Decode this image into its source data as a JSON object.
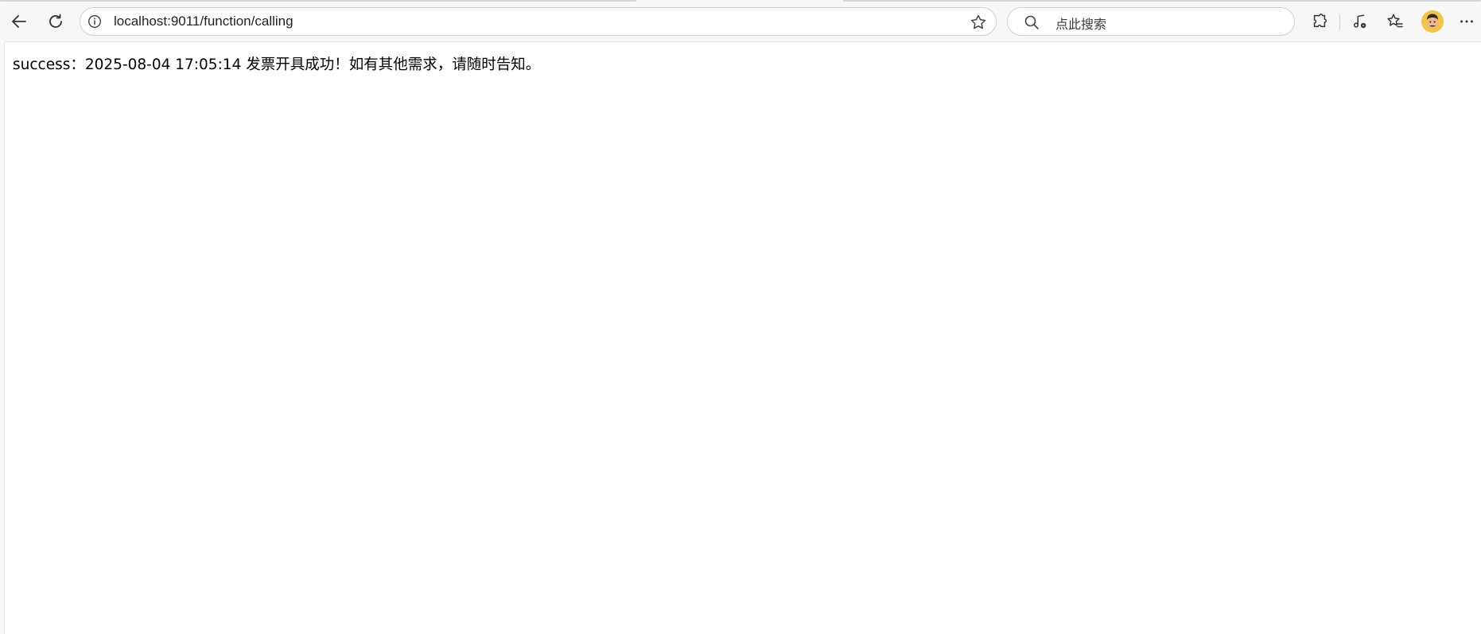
{
  "browser": {
    "address_bar": {
      "url": "localhost:9011/function/calling"
    },
    "search_box": {
      "placeholder": "点此搜索"
    },
    "icons": {
      "back": "back-arrow-icon",
      "refresh": "refresh-icon",
      "site_info": "info-icon",
      "favorite": "star-icon",
      "search": "search-icon",
      "extensions": "puzzle-icon",
      "media": "music-note-icon",
      "favorites_list": "favorites-icon",
      "profile": "avatar",
      "more": "more-dots-icon"
    }
  },
  "page": {
    "message": "success：2025-08-04 17:05:14 发票开具成功！如有其他需求，请随时告知。"
  },
  "colors": {
    "toolbar_bg": "#f7f7f7",
    "page_bg": "#ffffff",
    "text": "#000000",
    "avatar_bg": "#f4c542"
  }
}
